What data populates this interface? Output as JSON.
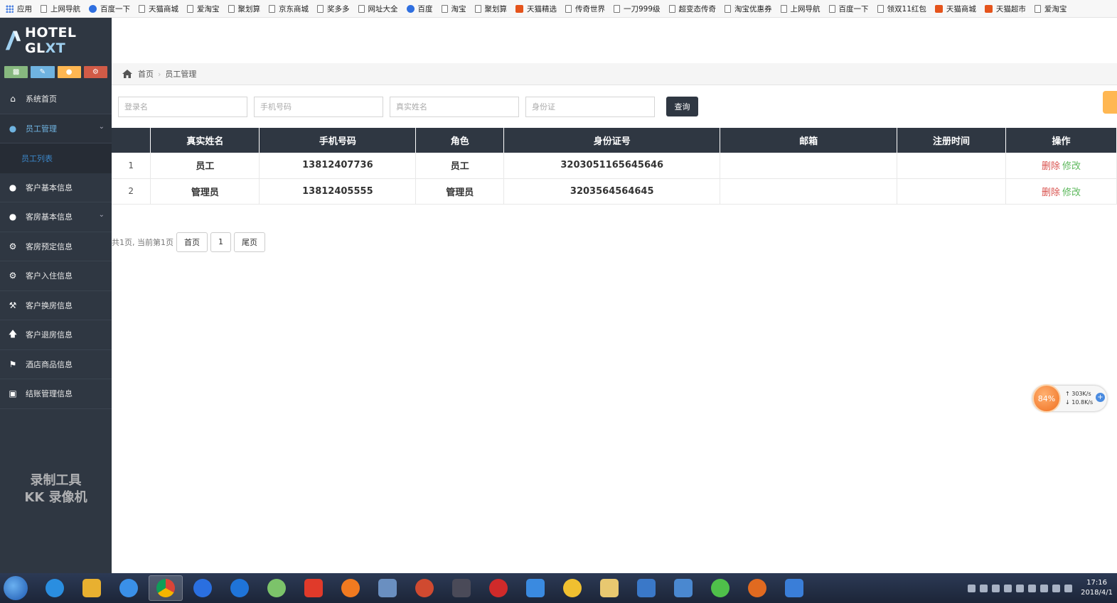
{
  "bookmarks": [
    "应用",
    "上网导航",
    "百度一下",
    "天猫商城",
    "爱淘宝",
    "聚划算",
    "京东商城",
    "奖多多",
    "网址大全",
    "百度",
    "淘宝",
    "聚划算",
    "天猫精选",
    "传奇世界",
    "一刀999级",
    "超变态传奇",
    "淘宝优惠券",
    "上网导航",
    "百度一下",
    "领双11红包",
    "天猫商城",
    "天猫超市",
    "爱淘宝"
  ],
  "logo": {
    "text_main": "HOTEL GL",
    "text_accent": "XT"
  },
  "sidebar": {
    "items": [
      {
        "label": "系统首页",
        "icon": "home-icon"
      },
      {
        "label": "员工管理",
        "icon": "users-icon"
      },
      {
        "label": "客户基本信息",
        "icon": "users-icon"
      },
      {
        "label": "客房基本信息",
        "icon": "users-icon"
      },
      {
        "label": "客房预定信息",
        "icon": "gear-icon"
      },
      {
        "label": "客户入住信息",
        "icon": "gear-icon"
      },
      {
        "label": "客户换房信息",
        "icon": "gavel-icon"
      },
      {
        "label": "客户退房信息",
        "icon": "arrow-up-icon"
      },
      {
        "label": "酒店商品信息",
        "icon": "flag-icon"
      },
      {
        "label": "结账管理信息",
        "icon": "lock-icon"
      }
    ],
    "sub_item": "员工列表",
    "watermark_line1": "录制工具",
    "watermark_line2": "KK 录像机"
  },
  "breadcrumb": {
    "home": "首页",
    "current": "员工管理"
  },
  "search": {
    "login_placeholder": "登录名",
    "phone_placeholder": "手机号码",
    "name_placeholder": "真实姓名",
    "id_placeholder": "身份证",
    "query_label": "查询"
  },
  "table": {
    "headers": [
      "",
      "真实姓名",
      "手机号码",
      "角色",
      "身份证号",
      "邮箱",
      "注册时间",
      "操作"
    ],
    "rows": [
      {
        "idx": "1",
        "name": "员工",
        "phone": "13812407736",
        "role": "员工",
        "idcard": "3203051165645646",
        "email": "",
        "regtime": ""
      },
      {
        "idx": "2",
        "name": "管理员",
        "phone": "13812405555",
        "role": "管理员",
        "idcard": "3203564564645",
        "email": "",
        "regtime": ""
      }
    ],
    "delete_label": "删除",
    "edit_label": "修改"
  },
  "pager": {
    "summary": "共1页, 当前第1页",
    "first": "首页",
    "page": "1",
    "last": "尾页"
  },
  "netwidget": {
    "percent": "84%",
    "up": "303K/s",
    "down": "10.8K/s"
  },
  "clock": {
    "time": "17:16",
    "date": "2018/4/1"
  },
  "colors": {
    "sidebar_bg": "#2f3742",
    "header_bg": "#2f3742",
    "delete": "#d9534f",
    "edit": "#5cb85c",
    "accent": "#6fb3e0"
  }
}
